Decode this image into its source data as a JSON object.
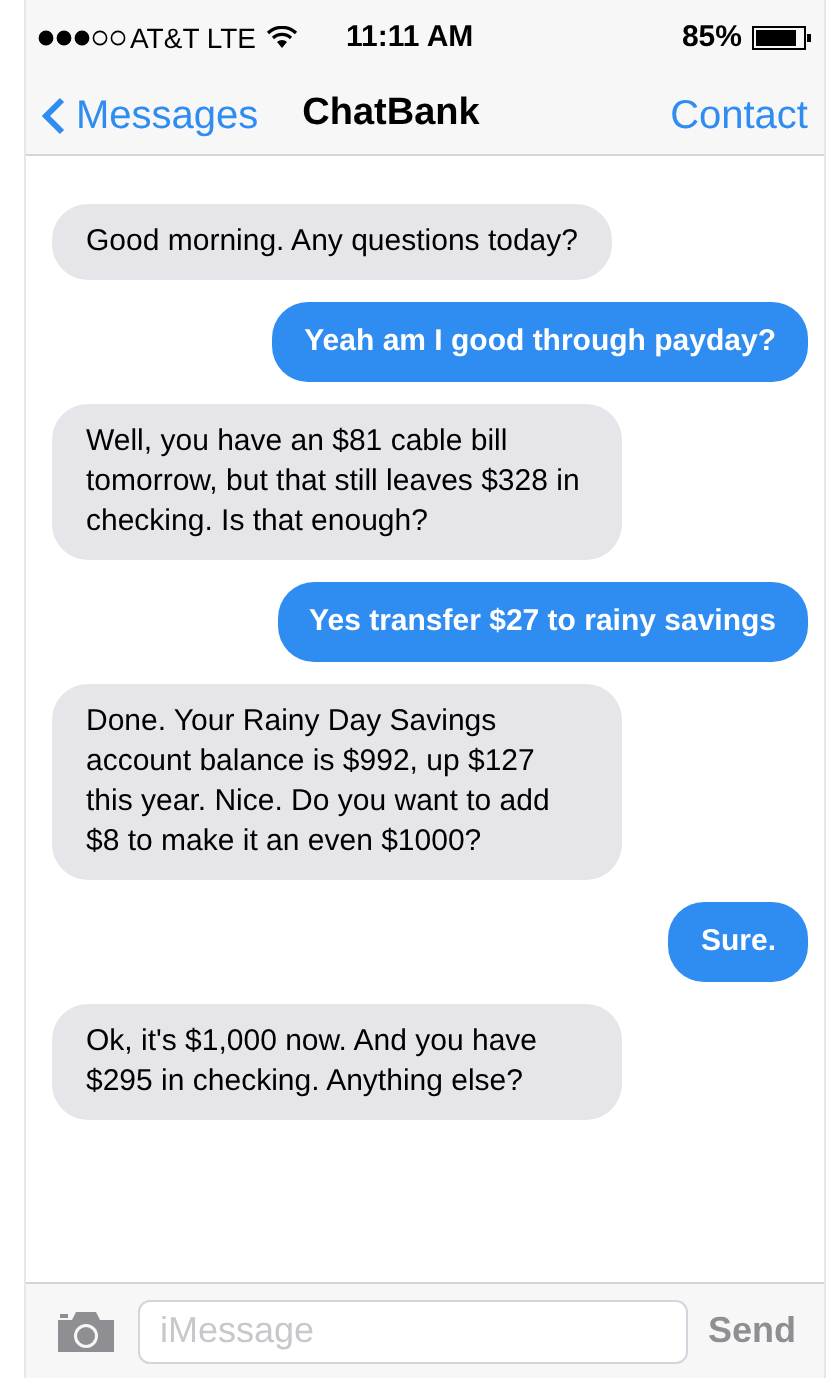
{
  "status_bar": {
    "carrier": "AT&T LTE",
    "time": "11:11 AM",
    "battery": "85%"
  },
  "nav_bar": {
    "back": "Messages",
    "title": "ChatBank",
    "action": "Contact"
  },
  "messages": [
    {
      "kind": "incoming",
      "text": "Good morning. Any questions today?"
    },
    {
      "kind": "outgoing",
      "text": "Yeah am I good through payday?"
    },
    {
      "kind": "incoming",
      "text": "Well, you have an $81 cable bill tomorrow, but that still leaves $328 in checking. Is that enough?"
    },
    {
      "kind": "outgoing",
      "text": "Yes transfer $27 to rainy savings"
    },
    {
      "kind": "incoming",
      "text": "Done. Your Rainy Day Savings account balance is $992, up $127 this year. Nice. Do you want to add $8 to make it an even $1000?"
    },
    {
      "kind": "outgoing",
      "text": "Sure."
    },
    {
      "kind": "incoming",
      "text": "Ok, it's $1,000 now. And you have $295 in checking. Anything else?"
    }
  ],
  "input_bar": {
    "placeholder": "iMessage",
    "send": "Send"
  }
}
